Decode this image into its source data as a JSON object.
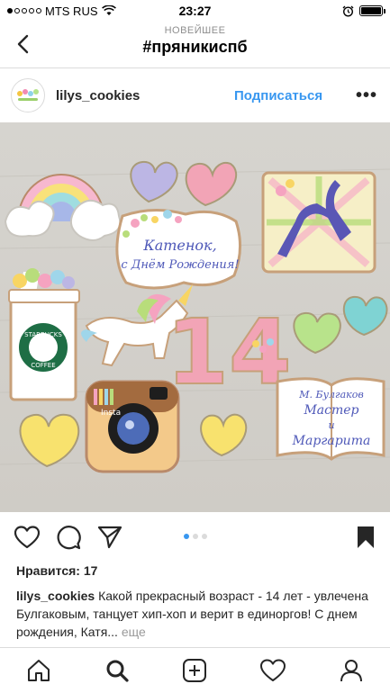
{
  "status_bar": {
    "carrier": "MTS RUS",
    "time": "23:27"
  },
  "header": {
    "subtitle": "НОВЕЙШЕЕ",
    "title": "#пряникиспб"
  },
  "post": {
    "username": "lilys_cookies",
    "follow_label": "Подписаться",
    "more_label": "•••",
    "likes_text": "Нравится: 17",
    "caption_user": "lilys_cookies",
    "caption_text": "Какой прекрасный возраст - 14 лет - увлечена Булгаковым,  танцует хип-хоп и верит в единоргов! С днем рождения, Катя",
    "caption_ellipsis": "...",
    "caption_more": "еще",
    "pager": {
      "count": 3,
      "active": 0
    },
    "photo_texts": {
      "plaque_line1": "Катенок,",
      "plaque_line2": "с Днём Рождения!",
      "number": "14",
      "starbucks_top": "STARBUCKS",
      "starbucks_bottom": "COFFEE",
      "insta": "Insta",
      "book_line1": "М. Булгаков",
      "book_line2": "Мастер",
      "book_line3": "и",
      "book_line4": "Маргарита"
    }
  },
  "icons": {
    "back": "chevron-left-icon",
    "like": "heart-icon",
    "comment": "comment-icon",
    "share": "send-icon",
    "save": "bookmark-icon",
    "tabs": [
      "home-icon",
      "search-icon",
      "add-icon",
      "activity-icon",
      "profile-icon"
    ]
  },
  "colors": {
    "accent": "#3897f0",
    "text": "#262626",
    "muted": "#8e8e8e",
    "border": "#dbdbdb"
  }
}
